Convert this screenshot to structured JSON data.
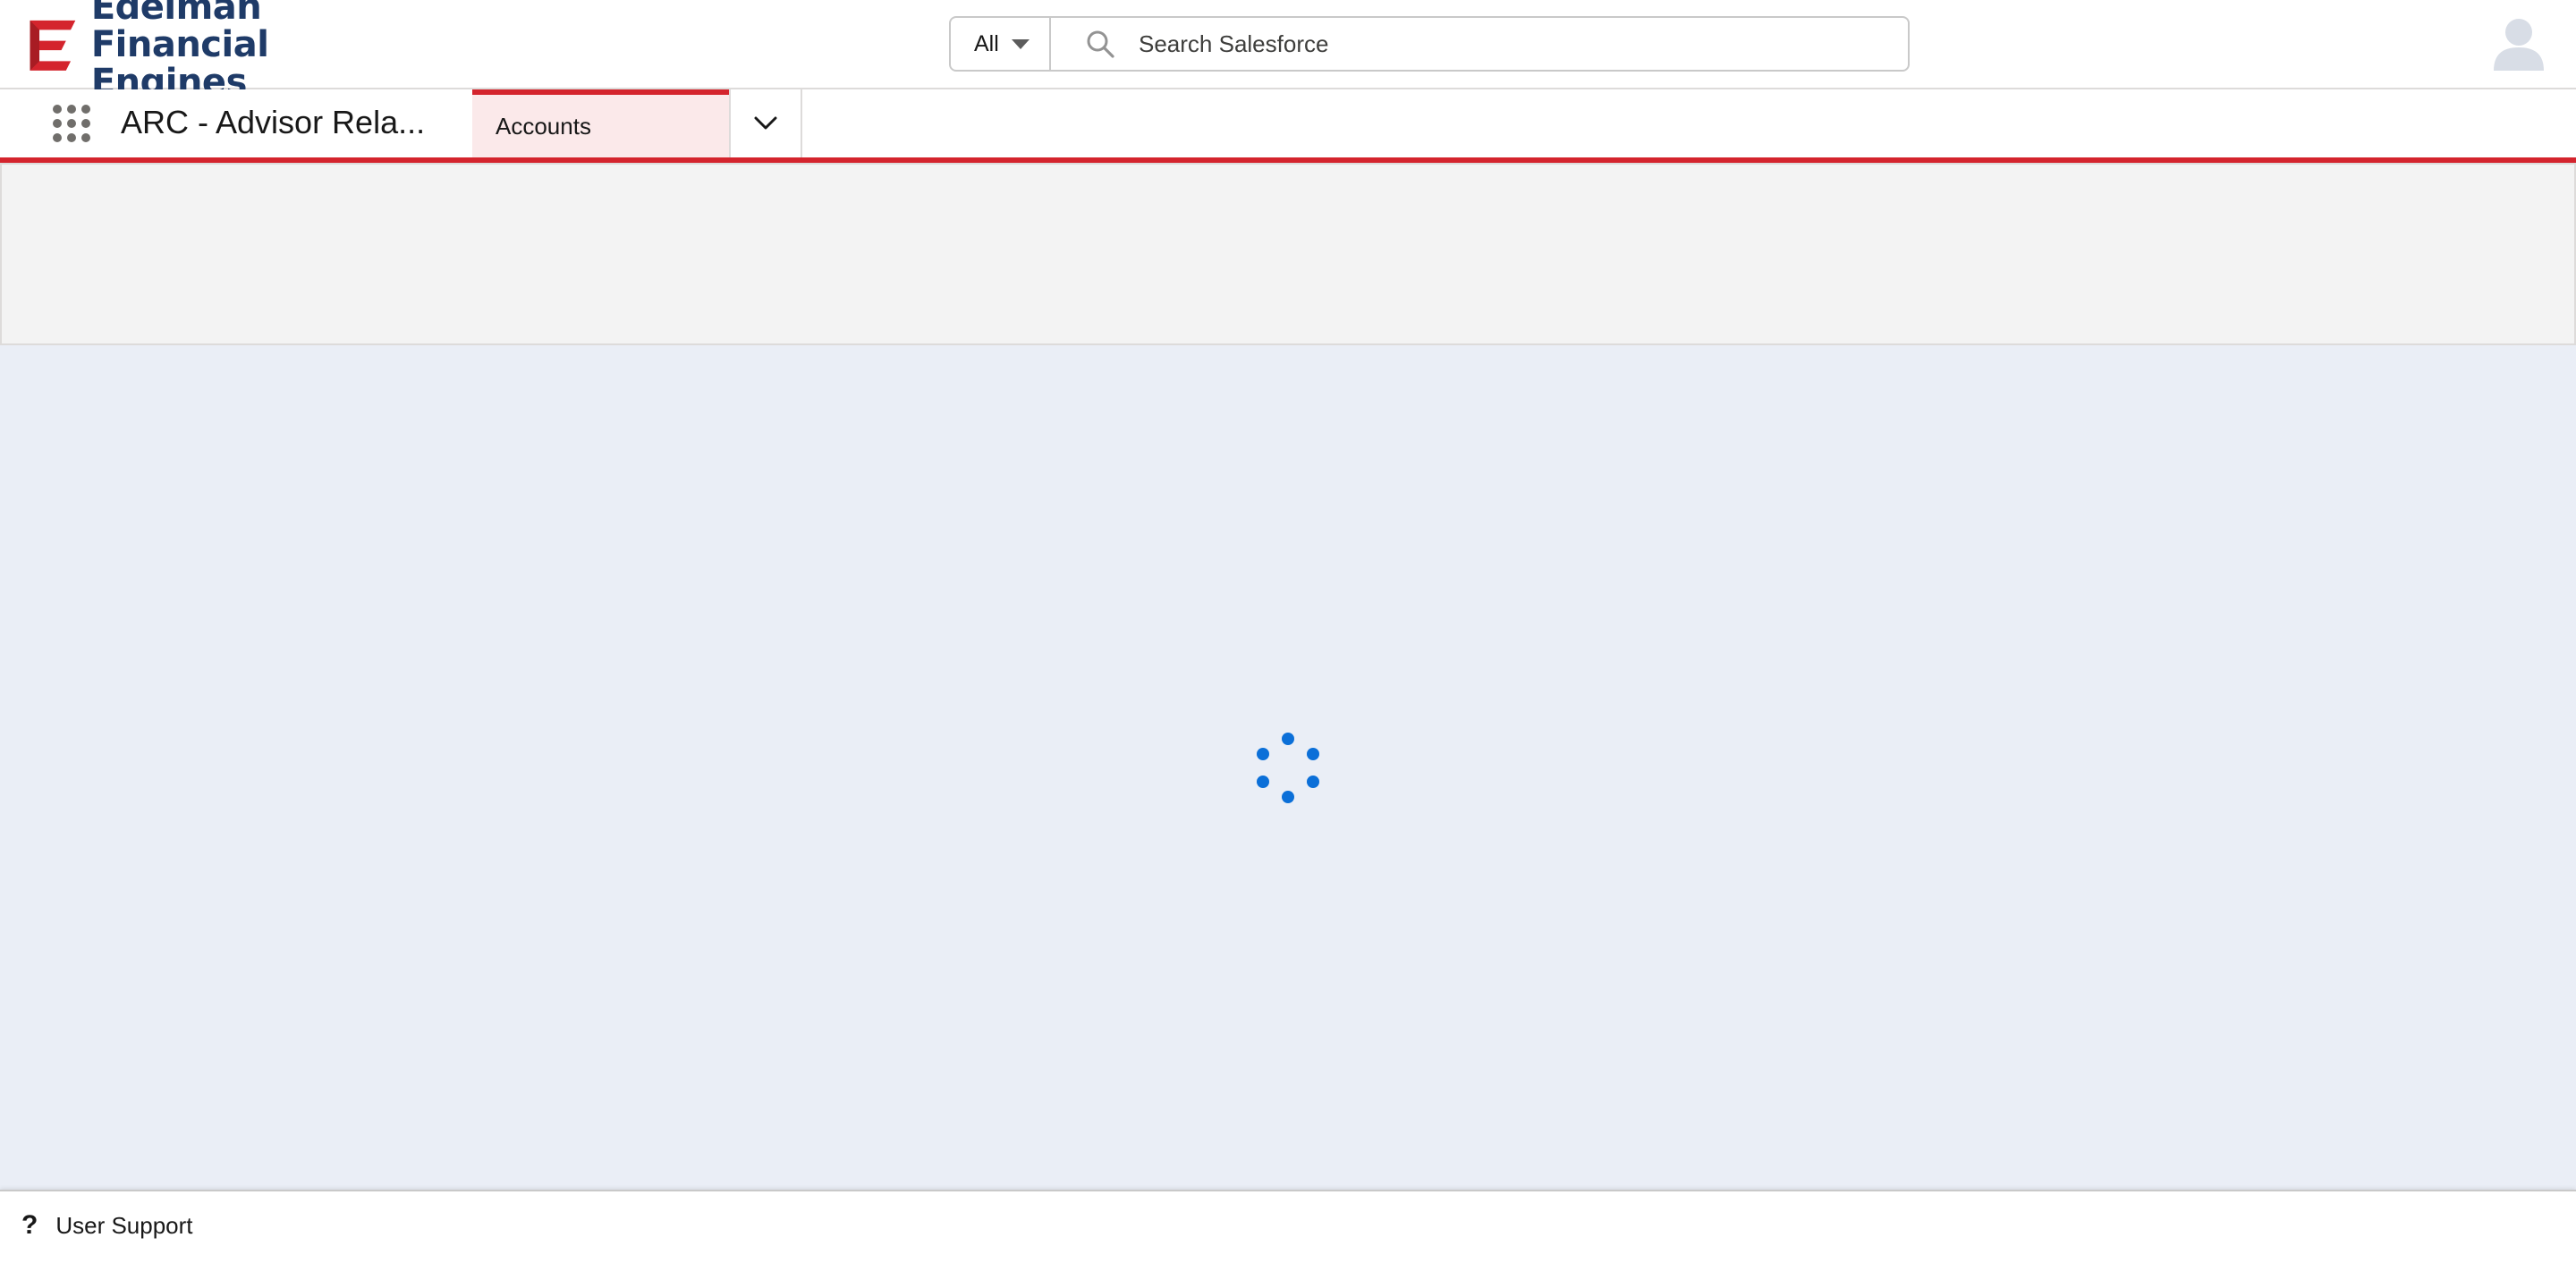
{
  "brand": {
    "line1": "Edelman",
    "line2": "Financial Engines",
    "text_color": "#1f3b68",
    "mark_color": "#d4242d"
  },
  "search": {
    "scope_label": "All",
    "placeholder": "Search Salesforce"
  },
  "nav": {
    "app_name": "ARC - Advisor Rela...",
    "tabs": [
      {
        "label": "Accounts",
        "active": true
      }
    ],
    "accent_color": "#d4242d"
  },
  "utility_bar": {
    "items": [
      {
        "label": "User Support",
        "icon": "question-icon"
      }
    ]
  },
  "status": {
    "loading": true,
    "spinner_color": "#0b6fd8"
  }
}
